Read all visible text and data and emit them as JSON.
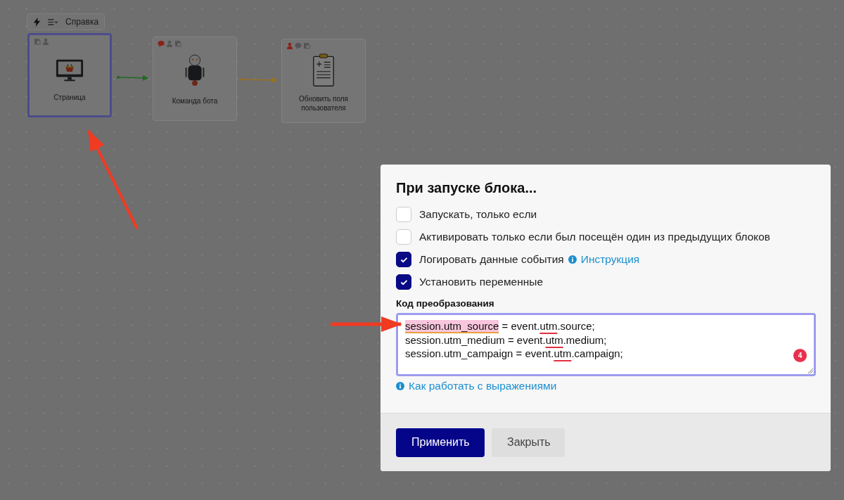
{
  "toolbar": {
    "help_label": "Справка"
  },
  "nodes": [
    {
      "title": "Страница",
      "kind": "monitor",
      "selected": true,
      "badges": [
        {
          "kind": "doc",
          "color": "#555555"
        },
        {
          "kind": "user",
          "color": "#555555"
        }
      ]
    },
    {
      "title": "Команда бота",
      "kind": "robot",
      "selected": false,
      "badges": [
        {
          "kind": "chat",
          "color": "#8a2218"
        },
        {
          "kind": "user",
          "color": "#555555"
        },
        {
          "kind": "doc",
          "color": "#555555"
        }
      ]
    },
    {
      "title": "Обновить поля пользователя",
      "kind": "clipboard",
      "selected": false,
      "badges": [
        {
          "kind": "user",
          "color": "#8a2218"
        },
        {
          "kind": "chat",
          "color": "#555555"
        },
        {
          "kind": "doc",
          "color": "#555555"
        }
      ]
    }
  ],
  "edges": [
    {
      "color": "#1f6a1f"
    },
    {
      "color": "#9a7020"
    }
  ],
  "dialog": {
    "title": "При запуске блока...",
    "options": [
      {
        "label": "Запускать, только если",
        "checked": false
      },
      {
        "label": "Активировать только если был посещён один из предыдущих блоков",
        "checked": false
      },
      {
        "label": "Логировать данные события",
        "checked": true,
        "link": "Инструкция"
      },
      {
        "label": "Установить переменные",
        "checked": true
      }
    ],
    "code_label": "Код преобразования",
    "code_lines": [
      [
        {
          "text": "session.utm_source",
          "kind": "highlight"
        },
        {
          "text": " = event.",
          "kind": "plain"
        },
        {
          "text": "utm",
          "kind": "error"
        },
        {
          "text": ".source;",
          "kind": "plain"
        }
      ],
      [
        {
          "text": "session.utm_medium = event.",
          "kind": "plain"
        },
        {
          "text": "utm",
          "kind": "error"
        },
        {
          "text": ".medium;",
          "kind": "plain"
        }
      ],
      [
        {
          "text": "session.utm_campaign = event.",
          "kind": "plain"
        },
        {
          "text": "utm",
          "kind": "error"
        },
        {
          "text": ".campaign;",
          "kind": "plain"
        }
      ]
    ],
    "error_count": "4",
    "help_link": "Как работать с выражениями",
    "buttons": [
      {
        "label": "Применить",
        "kind": "primary"
      },
      {
        "label": "Закрыть",
        "kind": "secondary"
      }
    ]
  }
}
